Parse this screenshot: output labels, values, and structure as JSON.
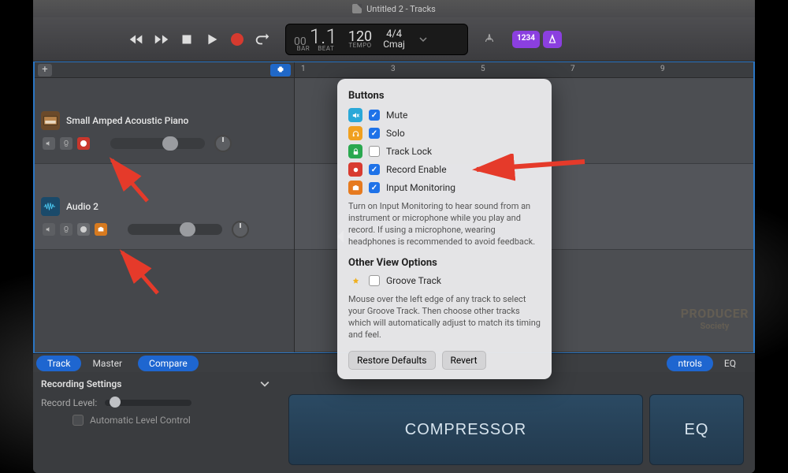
{
  "title": "Untitled 2 - Tracks",
  "transport": {
    "bar": "00",
    "beat": "1.1",
    "bar_label": "BAR",
    "beat_label": "BEAT",
    "tempo": "120",
    "tempo_label": "TEMPO",
    "time_sig": "4/4",
    "key": "Cmaj",
    "count_in_badge": "1234"
  },
  "ruler": {
    "ticks": [
      "1",
      "3",
      "5",
      "7",
      "9"
    ]
  },
  "tracks": [
    {
      "name": "Small Amped Acoustic Piano",
      "kind": "piano",
      "record_enabled": true,
      "input_monitor": false,
      "selected": false
    },
    {
      "name": "Audio 2",
      "kind": "audio",
      "record_enabled": false,
      "input_monitor": true,
      "selected": true
    }
  ],
  "popover": {
    "heading_buttons": "Buttons",
    "items": [
      {
        "icon": "mute",
        "label": "Mute",
        "checked": true
      },
      {
        "icon": "solo",
        "label": "Solo",
        "checked": true
      },
      {
        "icon": "lock",
        "label": "Track Lock",
        "checked": false
      },
      {
        "icon": "rec",
        "label": "Record Enable",
        "checked": true
      },
      {
        "icon": "imon",
        "label": "Input Monitoring",
        "checked": true
      }
    ],
    "desc1": "Turn on Input Monitoring to hear sound from an instrument or microphone while you play and record. If using a microphone, wearing headphones is recommended to avoid feedback.",
    "heading_other": "Other View Options",
    "other_items": [
      {
        "icon": "star",
        "label": "Groove Track",
        "checked": false
      }
    ],
    "desc2": "Mouse over the left edge of any track to select your Groove Track. Then choose other tracks which will automatically adjust to match its timing and feel.",
    "restore": "Restore Defaults",
    "revert": "Revert"
  },
  "inspector": {
    "tabs": {
      "track": "Track",
      "master": "Master",
      "compare": "Compare",
      "controls": "ntrols",
      "eq": "EQ"
    },
    "recording_settings": "Recording Settings",
    "record_level": "Record Level:",
    "alc": "Automatic Level Control"
  },
  "plugins": {
    "compressor": "COMPRESSOR",
    "eq": "EQ"
  },
  "watermark": {
    "line1": "PRODUCER",
    "line2": "Society"
  }
}
